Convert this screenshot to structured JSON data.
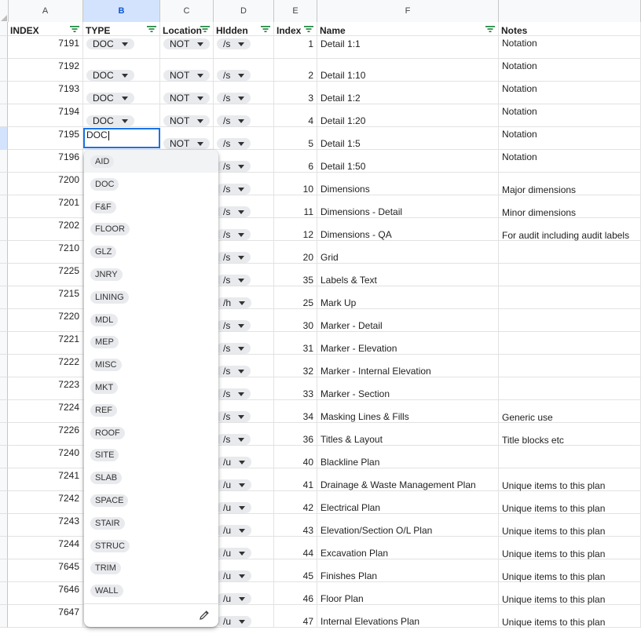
{
  "column_letters": [
    "A",
    "B",
    "C",
    "D",
    "E",
    "F",
    ""
  ],
  "headers": [
    "INDEX",
    "TYPE",
    "Location",
    "HIdden",
    "Index",
    "Name",
    "Notes"
  ],
  "rows": [
    {
      "a": "7191",
      "b": "DOC",
      "c": "NOT",
      "d": "/s",
      "e": "1",
      "f": "Detail 1:1",
      "g": "Notation"
    },
    {
      "a": "7192",
      "b": "DOC",
      "c": "NOT",
      "d": "/s",
      "e": "2",
      "f": "Detail 1:10",
      "g": "Notation"
    },
    {
      "a": "7193",
      "b": "DOC",
      "c": "NOT",
      "d": "/s",
      "e": "3",
      "f": "Detail 1:2",
      "g": "Notation"
    },
    {
      "a": "7194",
      "b": "DOC",
      "c": "NOT",
      "d": "/s",
      "e": "4",
      "f": "Detail 1:20",
      "g": "Notation"
    },
    {
      "a": "7195",
      "b": "",
      "c": "NOT",
      "d": "/s",
      "e": "5",
      "f": "Detail 1:5",
      "g": "Notation"
    },
    {
      "a": "7196",
      "b": "",
      "c": "",
      "d": "/s",
      "e": "6",
      "f": "Detail 1:50",
      "g": "Notation"
    },
    {
      "a": "7200",
      "b": "",
      "c": "",
      "d": "/s",
      "e": "10",
      "f": "Dimensions",
      "g": "Major dimensions"
    },
    {
      "a": "7201",
      "b": "",
      "c": "",
      "d": "/s",
      "e": "11",
      "f": "Dimensions - Detail",
      "g": "Minor dimensions"
    },
    {
      "a": "7202",
      "b": "",
      "c": "",
      "d": "/s",
      "e": "12",
      "f": "Dimensions - QA",
      "g": "For audit including audit labels"
    },
    {
      "a": "7210",
      "b": "",
      "c": "",
      "d": "/s",
      "e": "20",
      "f": "Grid",
      "g": ""
    },
    {
      "a": "7225",
      "b": "",
      "c": "",
      "d": "/s",
      "e": "35",
      "f": "Labels & Text",
      "g": ""
    },
    {
      "a": "7215",
      "b": "",
      "c": "",
      "d": "/h",
      "e": "25",
      "f": "Mark Up",
      "g": ""
    },
    {
      "a": "7220",
      "b": "",
      "c": "",
      "d": "/s",
      "e": "30",
      "f": "Marker - Detail",
      "g": ""
    },
    {
      "a": "7221",
      "b": "",
      "c": "",
      "d": "/s",
      "e": "31",
      "f": "Marker - Elevation",
      "g": ""
    },
    {
      "a": "7222",
      "b": "",
      "c": "",
      "d": "/s",
      "e": "32",
      "f": "Marker - Internal Elevation",
      "g": ""
    },
    {
      "a": "7223",
      "b": "",
      "c": "",
      "d": "/s",
      "e": "33",
      "f": "Marker - Section",
      "g": ""
    },
    {
      "a": "7224",
      "b": "",
      "c": "",
      "d": "/s",
      "e": "34",
      "f": "Masking Lines & Fills",
      "g": "Generic use"
    },
    {
      "a": "7226",
      "b": "",
      "c": "",
      "d": "/s",
      "e": "36",
      "f": "Titles & Layout",
      "g": "Title blocks etc"
    },
    {
      "a": "7240",
      "b": "",
      "c": "",
      "d": "/u",
      "e": "40",
      "f": "Blackline Plan",
      "g": ""
    },
    {
      "a": "7241",
      "b": "",
      "c": "",
      "d": "/u",
      "e": "41",
      "f": "Drainage & Waste Management Plan",
      "g": "Unique items to this plan"
    },
    {
      "a": "7242",
      "b": "",
      "c": "",
      "d": "/u",
      "e": "42",
      "f": "Electrical Plan",
      "g": "Unique items to this plan"
    },
    {
      "a": "7243",
      "b": "",
      "c": "",
      "d": "/u",
      "e": "43",
      "f": "Elevation/Section O/L Plan",
      "g": "Unique items to this plan"
    },
    {
      "a": "7244",
      "b": "",
      "c": "",
      "d": "/u",
      "e": "44",
      "f": "Excavation Plan",
      "g": "Unique items to this plan"
    },
    {
      "a": "7645",
      "b": "",
      "c": "",
      "d": "/u",
      "e": "45",
      "f": "Finishes Plan",
      "g": "Unique items to this plan"
    },
    {
      "a": "7646",
      "b": "",
      "c": "",
      "d": "/u",
      "e": "46",
      "f": "Floor Plan",
      "g": "Unique items to this plan"
    },
    {
      "a": "7647",
      "b": "",
      "c": "",
      "d": "/u",
      "e": "47",
      "f": "Internal Elevations Plan",
      "g": "Unique items to this plan"
    }
  ],
  "editor": {
    "value": "DOC"
  },
  "dropdown": {
    "options": [
      "AID",
      "DOC",
      "F&F",
      "FLOOR",
      "GLZ",
      "JNRY",
      "LINING",
      "MDL",
      "MEP",
      "MISC",
      "MKT",
      "REF",
      "ROOF",
      "SITE",
      "SLAB",
      "SPACE",
      "STAIR",
      "STRUC",
      "TRIM",
      "WALL"
    ],
    "highlighted": "AID",
    "edit_icon": "pencil-icon"
  },
  "colors": {
    "selection": "#d3e3fd",
    "accent": "#1a73e8",
    "filter_icon": "#188038"
  }
}
